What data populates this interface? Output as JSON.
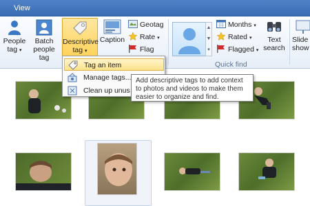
{
  "tabs": {
    "view": "View"
  },
  "ribbon": {
    "people_tag": [
      "People",
      "tag"
    ],
    "batch_people_tag": [
      "Batch",
      "people tag"
    ],
    "descriptive_tag": [
      "Descriptive",
      "tag"
    ],
    "caption": "Caption",
    "geotag": "Geotag",
    "rate": "Rate",
    "flag": "Flag",
    "months": "Months",
    "rated": "Rated",
    "flagged": "Flagged",
    "text_search": [
      "Text",
      "search"
    ],
    "slide_show": [
      "Slide",
      "show"
    ],
    "group_quick_find": "Quick find"
  },
  "menu": {
    "items": [
      "Tag an item",
      "Manage tags...",
      "Clean up unus"
    ]
  },
  "tooltip": {
    "text": "Add descriptive tags to add context to photos and videos to make them easier to organize and find."
  },
  "colors": {
    "ribbon_tab": "#3a6cb3",
    "highlight": "#ffd35a",
    "menu_highlight": "#ffe38c"
  }
}
